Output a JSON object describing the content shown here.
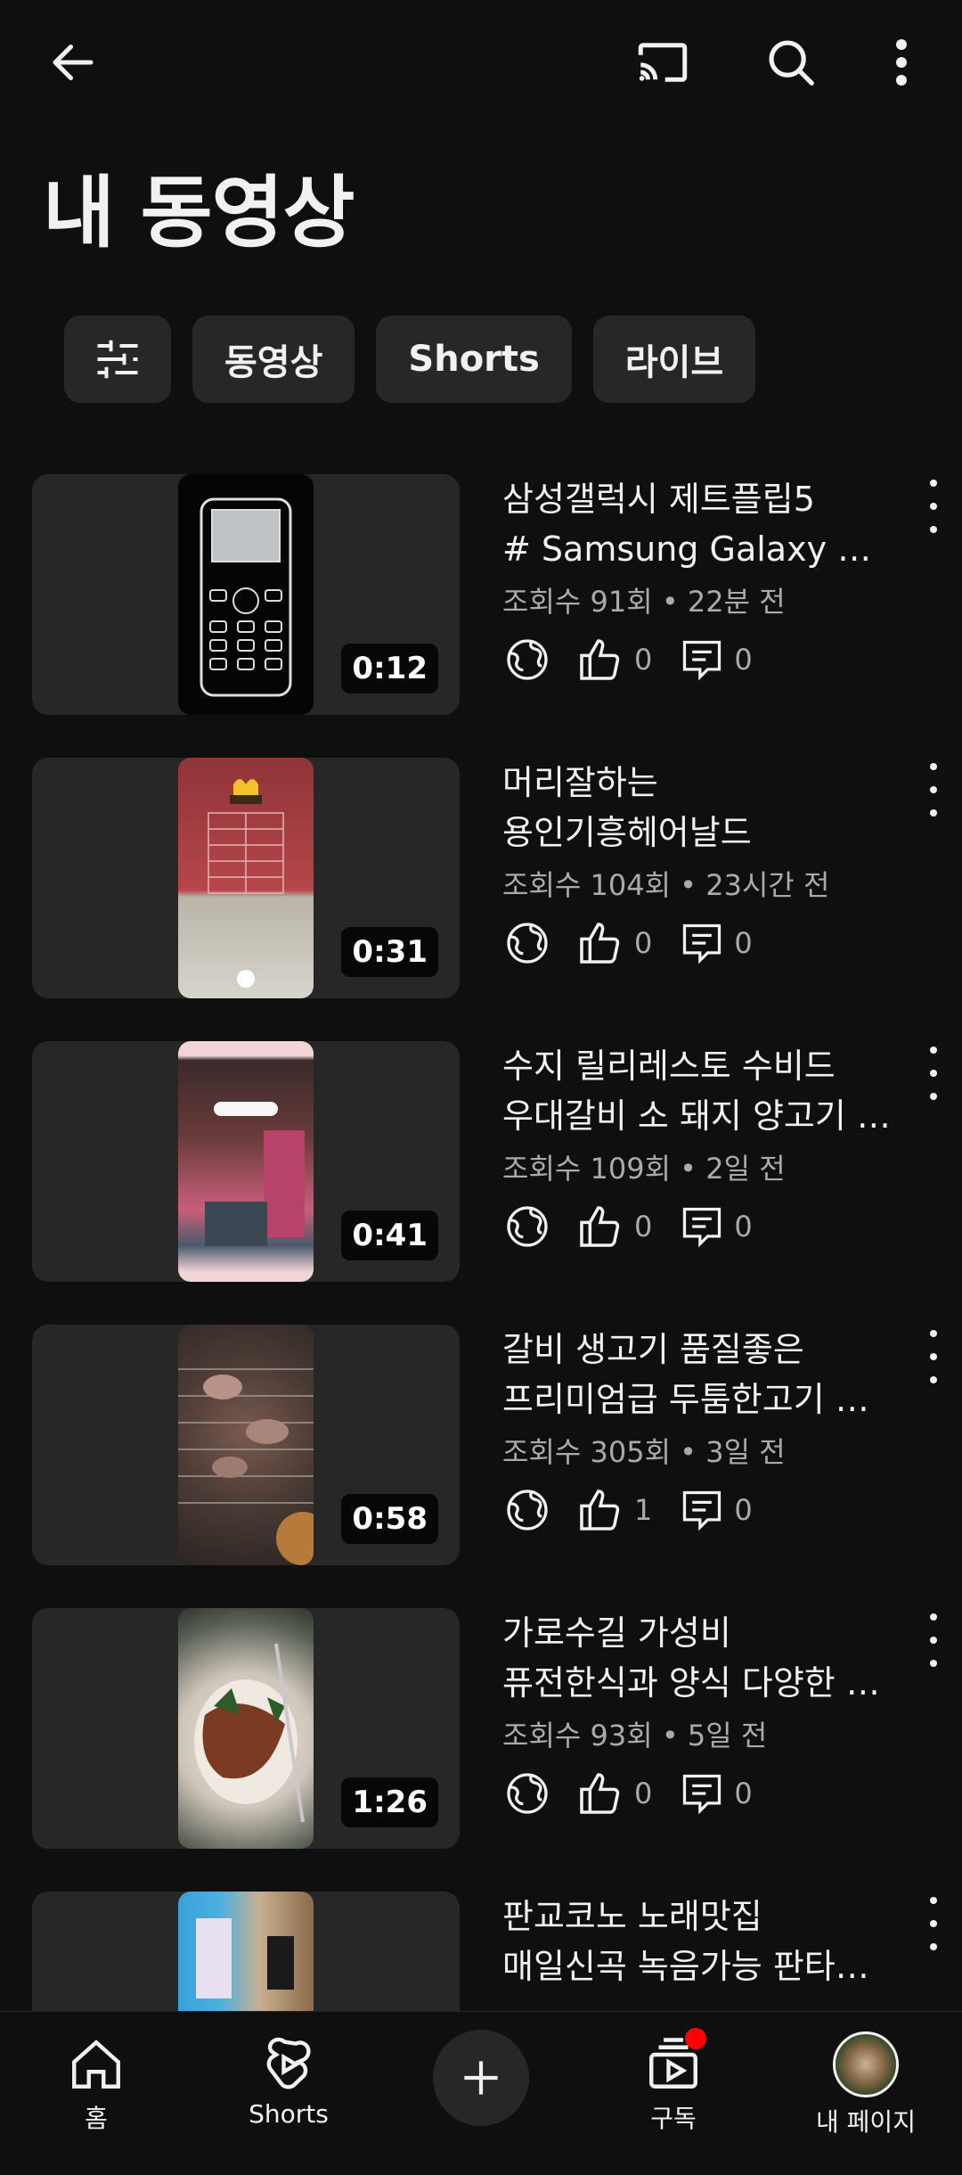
{
  "page_title": "내 동영상",
  "filters": [
    "동영상",
    "Shorts",
    "라이브"
  ],
  "videos": [
    {
      "title_line1": "삼성갤럭시 제트플립5",
      "title_line2": "# Samsung Galaxy Z …",
      "stats": "조회수 91회 • 22분 전",
      "duration": "0:12",
      "likes": "0",
      "comments": "0"
    },
    {
      "title_line1": "머리잘하는",
      "title_line2": "용인기흥헤어날드",
      "stats": "조회수 104회 • 23시간 전",
      "duration": "0:31",
      "likes": "0",
      "comments": "0"
    },
    {
      "title_line1": "수지 릴리레스토 수비드",
      "title_line2": "우대갈비 소 돼지 양고기 …",
      "stats": "조회수 109회 • 2일 전",
      "duration": "0:41",
      "likes": "0",
      "comments": "0"
    },
    {
      "title_line1": "갈비 생고기 품질좋은",
      "title_line2": "프리미엄급  두툼한고기 …",
      "stats": "조회수 305회 • 3일 전",
      "duration": "0:58",
      "likes": "1",
      "comments": "0"
    },
    {
      "title_line1": "가로수길 가성비",
      "title_line2": "퓨전한식과 양식 다양한 …",
      "stats": "조회수 93회 • 5일 전",
      "duration": "1:26",
      "likes": "0",
      "comments": "0"
    },
    {
      "title_line1": "판교코노 노래맛집",
      "title_line2": "매일신곡 녹음가능 판타…",
      "stats": "",
      "duration": "",
      "likes": "",
      "comments": ""
    }
  ],
  "bottom_nav": {
    "home": "홈",
    "shorts": "Shorts",
    "subscriptions": "구독",
    "you": "내 페이지"
  },
  "colors": {
    "background": "#0f0f0f",
    "chip": "#272727",
    "notification": "#ff0000"
  }
}
